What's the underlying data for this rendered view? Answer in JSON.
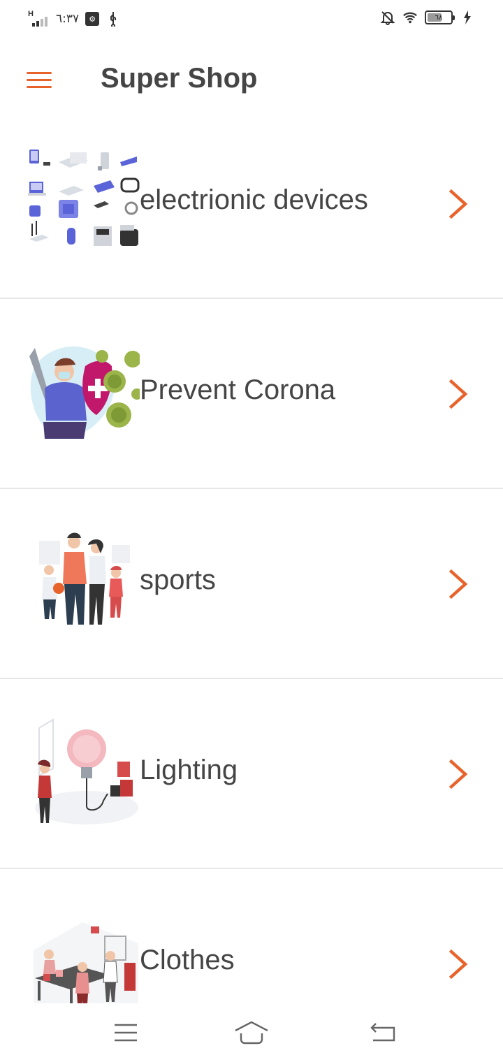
{
  "status_bar": {
    "network": "H",
    "time": "٦:٣٧",
    "battery_level": "٦٨",
    "icons": [
      "signal-icon",
      "usb-debug-icon",
      "usb-icon",
      "notifications-off-icon",
      "wifi-icon",
      "battery-icon",
      "charging-icon"
    ]
  },
  "app_bar": {
    "title": "Super Shop",
    "menu_icon": "hamburger-menu-icon"
  },
  "categories": [
    {
      "label": "electrionic devices",
      "thumbnail": "electronic-devices-illustration"
    },
    {
      "label": "Prevent Corona",
      "thumbnail": "prevent-corona-illustration"
    },
    {
      "label": "sports",
      "thumbnail": "sports-illustration"
    },
    {
      "label": "Lighting",
      "thumbnail": "lighting-illustration"
    },
    {
      "label": "Clothes",
      "thumbnail": "clothes-illustration"
    }
  ],
  "nav_bar": {
    "icons": [
      "recent-apps-icon",
      "home-icon",
      "back-icon"
    ]
  },
  "colors": {
    "accent": "#e8632b",
    "text": "#454545",
    "divider": "#e6e6e6"
  }
}
